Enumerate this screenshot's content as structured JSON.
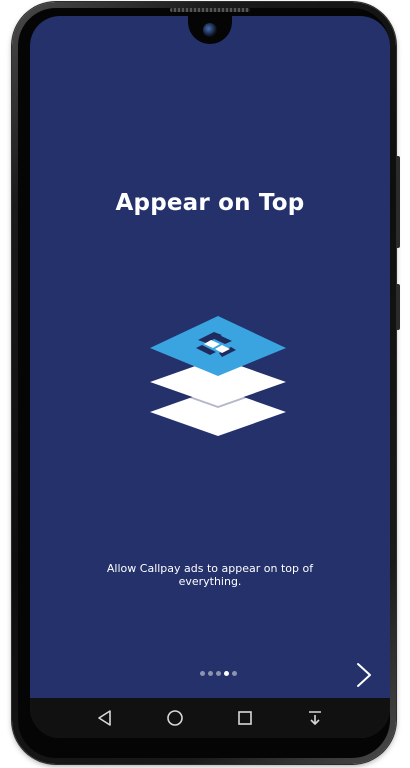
{
  "onboarding": {
    "title": "Appear on Top",
    "description": "Allow Callpay ads to appear on top of everything.",
    "illustration_icon": "stacked-layers-icon",
    "page_indicator": {
      "total": 5,
      "current": 4
    },
    "next_icon": "chevron-right-icon"
  },
  "navigation_bar": {
    "buttons": [
      "back-triangle-icon",
      "home-circle-icon",
      "recents-square-icon",
      "notification-pull-down-icon"
    ]
  },
  "colors": {
    "screen_background": "#24316b",
    "accent_layer": "#3aa4e0",
    "layer_white": "#ffffff",
    "nav_bar": "#111111"
  }
}
